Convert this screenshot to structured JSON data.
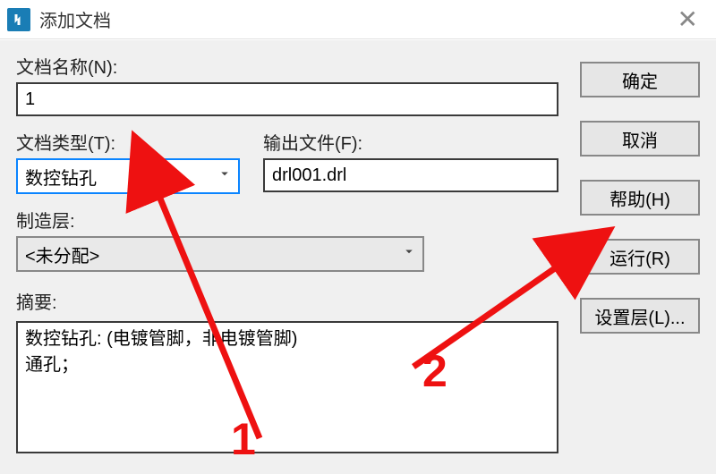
{
  "window": {
    "title": "添加文档"
  },
  "labels": {
    "docName": "文档名称(N):",
    "docType": "文档类型(T):",
    "outputFile": "输出文件(F):",
    "mfgLayer": "制造层:",
    "summary": "摘要:"
  },
  "values": {
    "docName": "1",
    "docType": "数控钻孔",
    "outputFile": "drl001.drl",
    "mfgLayer": "<未分配>",
    "summary": "数控钻孔: (电镀管脚，非电镀管脚)\n通孔；"
  },
  "buttons": {
    "ok": "确定",
    "cancel": "取消",
    "help": "帮助(H)",
    "run": "运行(R)",
    "setLayer": "设置层(L)..."
  },
  "annotations": {
    "one": "1",
    "two": "2"
  }
}
